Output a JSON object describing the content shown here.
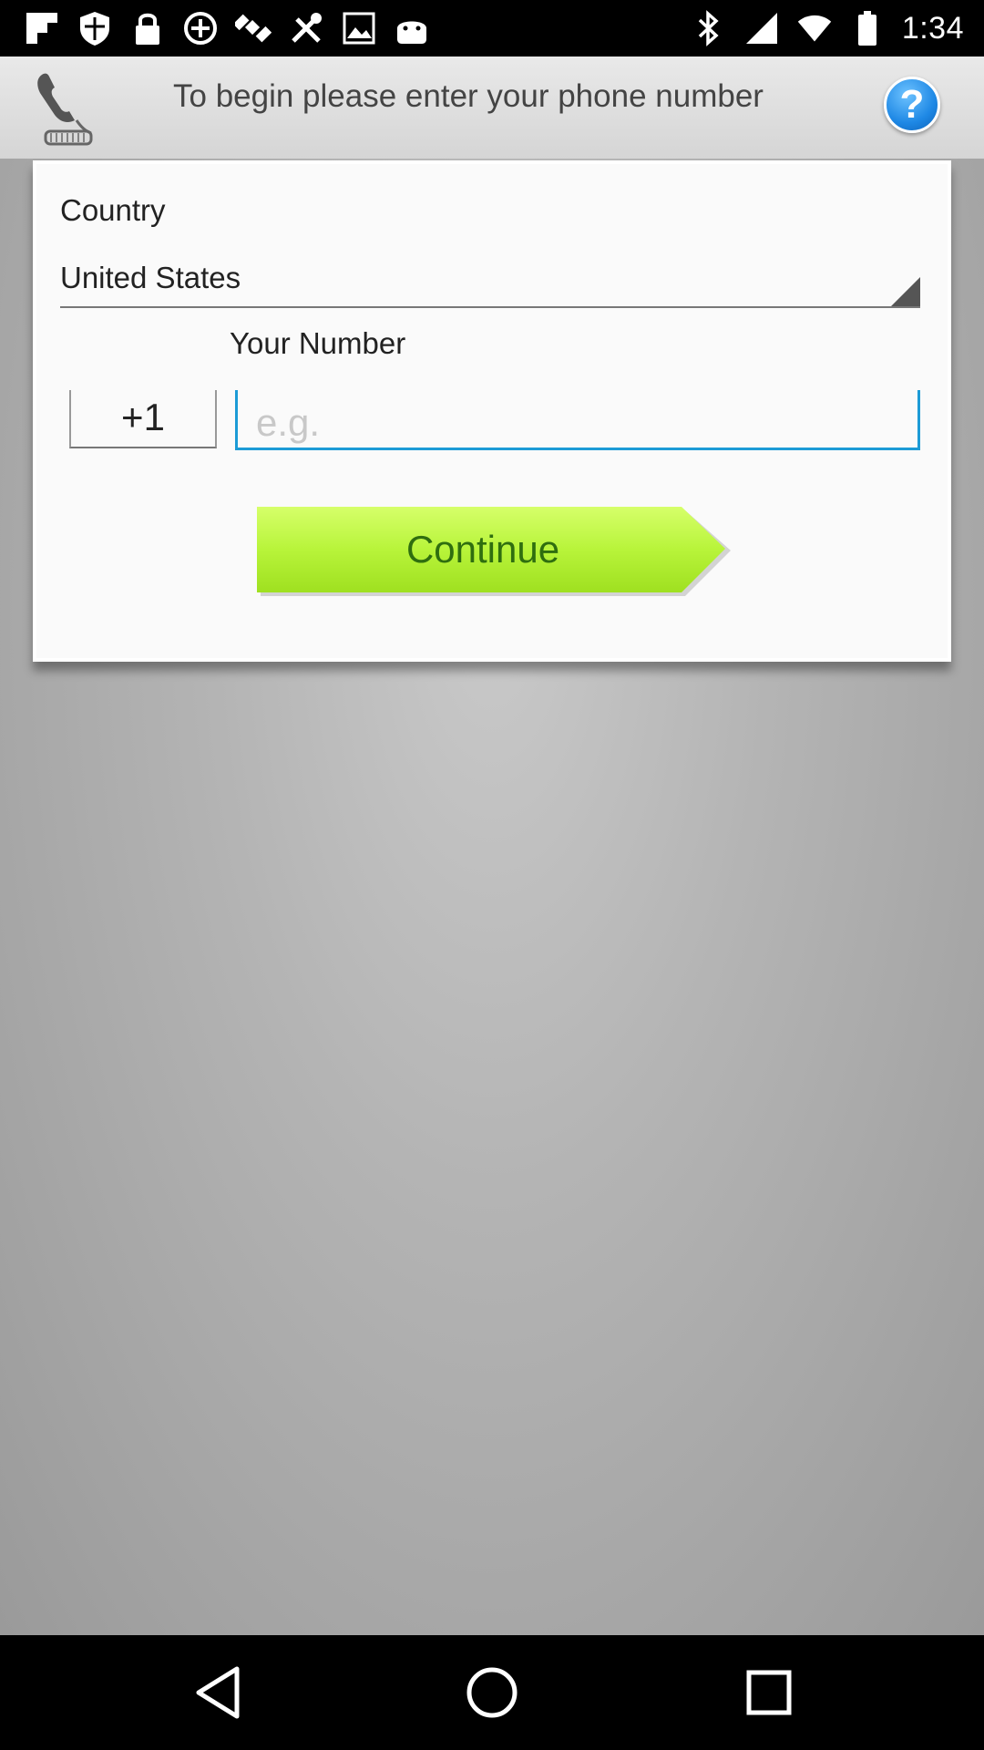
{
  "status_bar": {
    "time": "1:34",
    "left_icons": [
      "flipboard-icon",
      "shield-icon",
      "lock-icon",
      "pinwheel-icon",
      "satellite-icon",
      "tools-icon",
      "image-icon",
      "android-icon"
    ],
    "right_icons": [
      "bluetooth-icon",
      "signal-icon",
      "wifi-icon",
      "battery-icon"
    ]
  },
  "header": {
    "title": "To begin please enter your phone number",
    "help_label": "?"
  },
  "form": {
    "country_label": "Country",
    "country_value": "United States",
    "number_label": "Your Number",
    "country_code": "+1",
    "number_placeholder": "e.g.",
    "number_value": "",
    "continue_label": "Continue"
  },
  "colors": {
    "accent_blue": "#1c9bd6",
    "button_green": "#b8f43a",
    "help_blue": "#1e88e5"
  },
  "nav_bar": {
    "buttons": [
      "back-icon",
      "home-icon",
      "recents-icon"
    ]
  }
}
